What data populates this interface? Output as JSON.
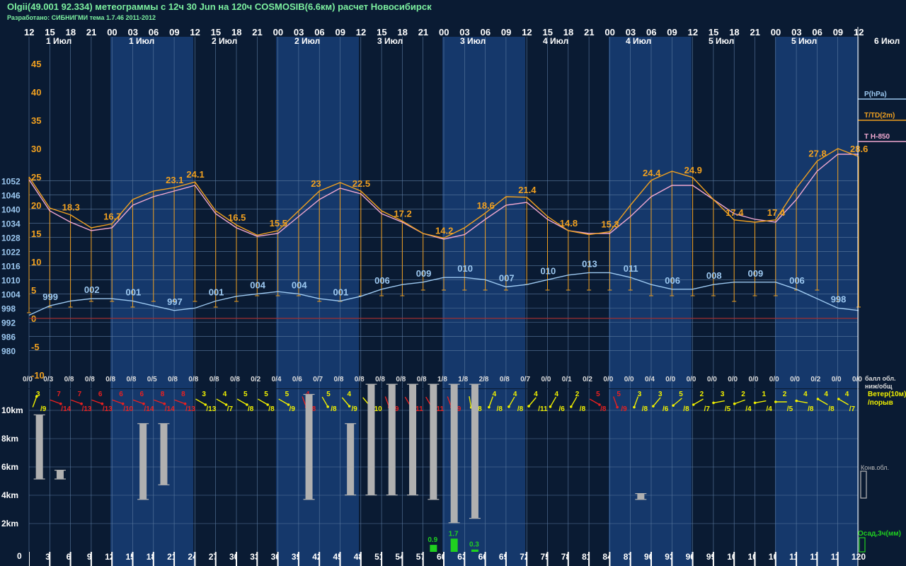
{
  "header": {
    "title": "Olgii(49.001 92.334) метеограммы с  12ч 30 Jun на 120ч COSMOSIB(6.6км) расчет Новосибирск",
    "subtitle": "Разработано: СИБНИГМИ тема 1.7.46 2011-2012"
  },
  "colors": {
    "bg_dark": "#0a1b33",
    "bg_light": "#15386b",
    "pressure": "#9cc8f0",
    "temp": "#f0a020",
    "t850": "#f0a8d0",
    "wind_yellow": "#f0f000",
    "wind_red": "#e82020",
    "cloud": "#b0b0b0",
    "precip": "#20d020",
    "zero_line": "#a03030",
    "grid": "#5a7aa0"
  },
  "chart_data": {
    "type": "line",
    "hour_labels": [
      "12",
      "15",
      "18",
      "21",
      "00",
      "03",
      "06",
      "09",
      "12",
      "15",
      "18",
      "21",
      "00",
      "03",
      "06",
      "09",
      "12",
      "15",
      "18",
      "21",
      "00",
      "03",
      "06",
      "09",
      "12",
      "15",
      "18",
      "21",
      "00",
      "03",
      "06",
      "09",
      "12",
      "15",
      "18",
      "21",
      "00",
      "03",
      "06",
      "09",
      "12"
    ],
    "date_labels": [
      "1 Июл",
      "1 Июл",
      "2 Июл",
      "2 Июл",
      "3 Июл",
      "3 Июл",
      "4 Июл",
      "4 Июл",
      "5 Июл",
      "5 Июл",
      "6 Июл"
    ],
    "forecast_hours": [
      0,
      3,
      6,
      9,
      12,
      15,
      18,
      21,
      24,
      27,
      30,
      33,
      36,
      39,
      42,
      45,
      48,
      51,
      54,
      57,
      60,
      63,
      66,
      69,
      72,
      75,
      78,
      81,
      84,
      87,
      90,
      93,
      96,
      99,
      102,
      105,
      108,
      111,
      114,
      117,
      120
    ],
    "pressure_axis": [
      1052,
      1046,
      1040,
      1034,
      1028,
      1022,
      1016,
      1010,
      1004,
      998,
      992,
      986,
      980
    ],
    "temp_axis": [
      45,
      40,
      35,
      30,
      25,
      20,
      15,
      10,
      5,
      0,
      -5,
      -10
    ],
    "legend": [
      "P(hPa)",
      "T/TD(2m)",
      "T H-850"
    ],
    "series": [
      {
        "name": "P(hPa)",
        "values": [
          995,
          999,
          1001,
          1002,
          1002,
          1001,
          999,
          997,
          998,
          1001,
          1003,
          1004,
          1005,
          1004,
          1002,
          1001,
          1003,
          1006,
          1008,
          1009,
          1011,
          1011,
          1010,
          1007,
          1008,
          1010,
          1012,
          1013,
          1013,
          1011,
          1008,
          1006,
          1006,
          1008,
          1009,
          1009,
          1009,
          1006,
          1002,
          998,
          997
        ]
      },
      {
        "name": "T/TD(2m)",
        "values": [
          25,
          19.5,
          18.3,
          16,
          16.7,
          21,
          22.5,
          23.1,
          24.1,
          19,
          16.5,
          14.7,
          15.5,
          19,
          22.5,
          24,
          22.5,
          19,
          17.2,
          15,
          14.2,
          16,
          18.6,
          21.5,
          21.4,
          18,
          15.5,
          14.8,
          15.3,
          20,
          24.4,
          26,
          24.9,
          21,
          17.4,
          17,
          17.4,
          23,
          27.8,
          30,
          28.6
        ]
      },
      {
        "name": "T H-850",
        "values": [
          24.5,
          19,
          17,
          15.5,
          16,
          20,
          21.5,
          22.5,
          23.5,
          18.5,
          16,
          14.5,
          15,
          18,
          21,
          23,
          22,
          18.5,
          17,
          15,
          14,
          14.8,
          17.5,
          20,
          20.5,
          17.5,
          15.5,
          15,
          15,
          18,
          21.5,
          23.5,
          23.5,
          21,
          18.5,
          17.5,
          17,
          21,
          26,
          29,
          29
        ]
      }
    ],
    "dew_bars": [
      1,
      2,
      2,
      3,
      3,
      2,
      3,
      3,
      3,
      2,
      3,
      4,
      4,
      4,
      3,
      3,
      4,
      4,
      4,
      5,
      5,
      5,
      5,
      5,
      6,
      5,
      5,
      5,
      5,
      5,
      4,
      4,
      4,
      4,
      3,
      4,
      4,
      5,
      5,
      3,
      2
    ],
    "temp_labels": [
      {
        "i": 2,
        "t": "18.3"
      },
      {
        "i": 4,
        "t": "16.7"
      },
      {
        "i": 7,
        "t": "23.1"
      },
      {
        "i": 8,
        "t": "24.1"
      },
      {
        "i": 10,
        "t": "16.5"
      },
      {
        "i": 12,
        "t": "15.5"
      },
      {
        "i": 14,
        "t": "23"
      },
      {
        "i": 16,
        "t": "22.5"
      },
      {
        "i": 18,
        "t": "17.2"
      },
      {
        "i": 20,
        "t": "14.2"
      },
      {
        "i": 22,
        "t": "18.6"
      },
      {
        "i": 24,
        "t": "21.4"
      },
      {
        "i": 26,
        "t": "14.8"
      },
      {
        "i": 28,
        "t": "15.3"
      },
      {
        "i": 30,
        "t": "24.4"
      },
      {
        "i": 32,
        "t": "24.9"
      },
      {
        "i": 34,
        "t": "17.4"
      },
      {
        "i": 36,
        "t": "17.4"
      },
      {
        "i": 38,
        "t": "27.8"
      },
      {
        "i": 40,
        "t": "28.6"
      }
    ],
    "pressure_labels": [
      {
        "i": 1,
        "t": "999"
      },
      {
        "i": 3,
        "t": "002"
      },
      {
        "i": 5,
        "t": "001"
      },
      {
        "i": 7,
        "t": "997"
      },
      {
        "i": 9,
        "t": "001"
      },
      {
        "i": 11,
        "t": "004"
      },
      {
        "i": 13,
        "t": "004"
      },
      {
        "i": 15,
        "t": "001"
      },
      {
        "i": 17,
        "t": "006"
      },
      {
        "i": 19,
        "t": "009"
      },
      {
        "i": 21,
        "t": "010"
      },
      {
        "i": 23,
        "t": "007"
      },
      {
        "i": 25,
        "t": "010"
      },
      {
        "i": 27,
        "t": "013"
      },
      {
        "i": 29,
        "t": "011"
      },
      {
        "i": 31,
        "t": "006"
      },
      {
        "i": 33,
        "t": "008"
      },
      {
        "i": 35,
        "t": "009"
      },
      {
        "i": 37,
        "t": "006"
      },
      {
        "i": 39,
        "t": "998"
      }
    ],
    "cloud_fraction": [
      "0/0",
      "0/3",
      "0/8",
      "0/8",
      "0/8",
      "0/8",
      "0/5",
      "0/8",
      "0/8",
      "0/8",
      "0/8",
      "0/2",
      "0/4",
      "0/6",
      "0/7",
      "0/8",
      "0/8",
      "0/8",
      "0/8",
      "0/8",
      "1/8",
      "1/8",
      "2/8",
      "0/8",
      "0/7",
      "0/0",
      "0/1",
      "0/2",
      "0/0",
      "0/0",
      "0/4",
      "0/0",
      "0/0",
      "0/0",
      "0/0",
      "0/0",
      "0/0",
      "0/0",
      "0/2",
      "0/0",
      "0/0"
    ],
    "cloud_label": "балл обл.\nниж/общ",
    "wind_dir_deg": [
      200,
      290,
      290,
      290,
      290,
      290,
      290,
      290,
      300,
      300,
      300,
      300,
      300,
      340,
      330,
      320,
      320,
      340,
      330,
      330,
      340,
      350,
      20,
      30,
      40,
      30,
      30,
      300,
      340,
      20,
      40,
      50,
      60,
      80,
      70,
      80,
      90,
      100,
      120,
      120,
      120
    ],
    "wind_red": [
      false,
      true,
      true,
      true,
      true,
      true,
      true,
      true,
      false,
      false,
      false,
      false,
      false,
      true,
      false,
      false,
      false,
      true,
      true,
      true,
      true,
      false,
      false,
      false,
      false,
      false,
      false,
      true,
      true,
      false,
      false,
      false,
      false,
      false,
      false,
      false,
      false,
      false,
      false,
      false,
      false
    ],
    "wind_speed": [
      "3",
      "7",
      "7",
      "6",
      "6",
      "6",
      "8",
      "8",
      "3",
      "4",
      "5",
      "5",
      "5",
      "4",
      "5",
      "4",
      "6",
      "5",
      "7",
      "6",
      "5",
      "4",
      "4",
      "4",
      "4",
      "4",
      "2",
      "5",
      "5",
      "3",
      "3",
      "5",
      "2",
      "3",
      "2",
      "1",
      "2",
      "4",
      "4",
      "4"
    ],
    "wind_gust": [
      "/9",
      "/14",
      "/13",
      "/13",
      "/10",
      "/14",
      "/14",
      "/13",
      "/13",
      "/7",
      "/8",
      "/8",
      "/9",
      "/8",
      "/8",
      "/9",
      "/10",
      "/9",
      "/11",
      "/11",
      "/9",
      "/8",
      "/8",
      "/8",
      "/11",
      "/6",
      "/8",
      "/8",
      "/9",
      "/8",
      "/6",
      "/8",
      "/7",
      "/5",
      "/4",
      "/4",
      "/5",
      "/8",
      "/8",
      "/7"
    ],
    "wind_label": "Ветер(10м)\n/порыв",
    "height_axis": [
      "10km",
      "8km",
      "6km",
      "4km",
      "2km"
    ],
    "conv_clouds": [
      {
        "i": 0.5,
        "base": 5.0,
        "top": 9.4
      },
      {
        "i": 1.5,
        "base": 5.0,
        "top": 5.6
      },
      {
        "i": 5.5,
        "base": 3.6,
        "top": 8.8
      },
      {
        "i": 6.5,
        "base": 4.6,
        "top": 8.8
      },
      {
        "i": 13.5,
        "base": 3.6,
        "top": 10.8
      },
      {
        "i": 15.5,
        "base": 3.9,
        "top": 8.8
      },
      {
        "i": 16.5,
        "base": 3.9,
        "top": 11.5
      },
      {
        "i": 17.5,
        "base": 3.9,
        "top": 11.5
      },
      {
        "i": 18.5,
        "base": 3.9,
        "top": 11.5
      },
      {
        "i": 19.5,
        "base": 3.6,
        "top": 11.5
      },
      {
        "i": 20.5,
        "base": 2.0,
        "top": 11.5
      },
      {
        "i": 21.5,
        "base": 2.3,
        "top": 11.5
      },
      {
        "i": 29.5,
        "base": 3.6,
        "top": 4.0
      }
    ],
    "conv_label": "Конв.обл.",
    "precip": [
      {
        "i": 19.5,
        "v": 0.9,
        "t": "0.9"
      },
      {
        "i": 20.5,
        "v": 1.7,
        "t": "1.7"
      },
      {
        "i": 21.5,
        "v": 0.3,
        "t": "0.3"
      }
    ],
    "precip_label": "Осад,3ч(мм)",
    "bottom_axis_zero": "0"
  }
}
